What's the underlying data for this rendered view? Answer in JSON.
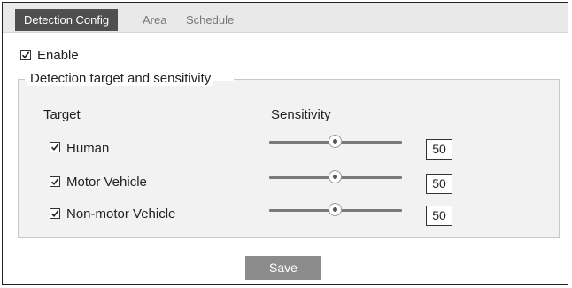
{
  "tabs": [
    {
      "label": "Detection Config",
      "active": true
    },
    {
      "label": "Area",
      "active": false
    },
    {
      "label": "Schedule",
      "active": false
    }
  ],
  "enable": {
    "label": "Enable",
    "checked": true
  },
  "group": {
    "legend": "Detection target and sensitivity",
    "col_target": "Target",
    "col_sensitivity": "Sensitivity",
    "rows": [
      {
        "label": "Human",
        "checked": true,
        "value": "50",
        "level": 0.5
      },
      {
        "label": "Motor Vehicle",
        "checked": true,
        "value": "50",
        "level": 0.5
      },
      {
        "label": "Non-motor Vehicle",
        "checked": true,
        "value": "50",
        "level": 0.5
      }
    ]
  },
  "save_label": "Save",
  "colors": {
    "active_tab": "#4f4f4f",
    "save_button": "#8c8c8c"
  }
}
